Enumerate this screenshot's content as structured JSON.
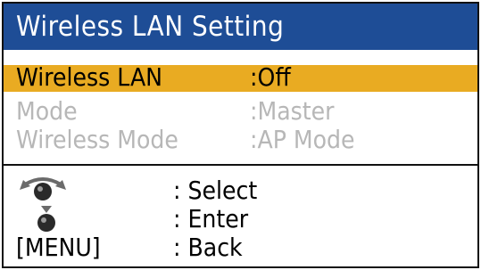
{
  "window": {
    "title": "Wireless LAN Setting"
  },
  "settings": [
    {
      "label": "Wireless LAN",
      "value": ":Off",
      "state": "selected"
    },
    {
      "label": "Mode",
      "value": ":Master",
      "state": "disabled"
    },
    {
      "label": "Wireless Mode",
      "value": ":AP Mode",
      "state": "disabled"
    }
  ],
  "help": [
    {
      "key_icon": "rotate-knob-icon",
      "description": ": Select"
    },
    {
      "key_icon": "push-knob-icon",
      "description": ": Enter"
    },
    {
      "key_label": "[MENU]",
      "description": ": Back"
    }
  ],
  "colors": {
    "title_bar": "#1e4d96",
    "highlight": "#e9ab22",
    "disabled_text": "#b7b7b7"
  }
}
